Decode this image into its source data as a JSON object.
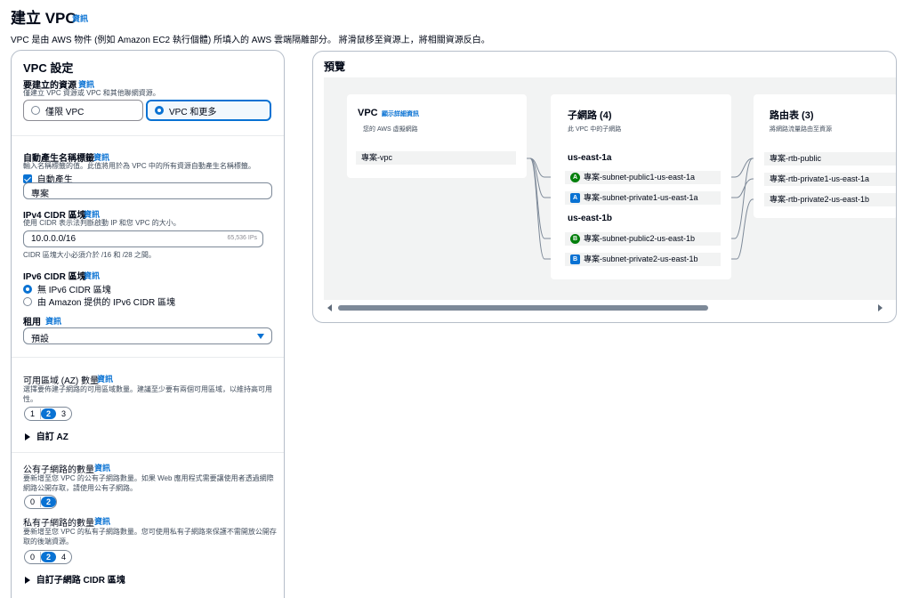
{
  "header": {
    "title": "建立 VPC",
    "info": "資訊",
    "description": "VPC 是由 AWS 物件 (例如 Amazon EC2 執行個體) 所填入的 AWS 雲端隔離部分。 將滑鼠移至資源上，將相關資源反白。"
  },
  "settings": {
    "title": "VPC 設定",
    "resources": {
      "label": "要建立的資源",
      "info": "資訊",
      "desc": "僅建立 VPC 資源或 VPC 和其他聯網資源。",
      "option_vpc_only": "僅限 VPC",
      "option_vpc_more": "VPC 和更多",
      "selected": "VPC 和更多"
    },
    "name_tag": {
      "label": "自動產生名稱標籤",
      "info": "資訊",
      "desc": "輸入名稱標籤的值。此值將用於為 VPC 中的所有資源自動產生名稱標籤。",
      "checkbox_label": "自動產生",
      "checked": true,
      "value": "專案"
    },
    "ipv4": {
      "label": "IPv4 CIDR 區塊",
      "info": "資訊",
      "desc": "使用 CIDR 表示法判斷啟動 IP 和您 VPC 的大小。",
      "value": "10.0.0.0/16",
      "ips_hint": "65,536 IPs",
      "constraint": "CIDR 區塊大小必須介於 /16 和 /28 之間。"
    },
    "ipv6": {
      "label": "IPv6 CIDR 區塊",
      "info": "資訊",
      "option_none": "無 IPv6 CIDR 區塊",
      "option_amazon": "由 Amazon 提供的 IPv6 CIDR 區塊",
      "selected": "無 IPv6 CIDR 區塊"
    },
    "tenancy": {
      "label": "租用",
      "info": "資訊",
      "value": "預設"
    },
    "az": {
      "label": "可用區域 (AZ) 數量",
      "info": "資訊",
      "desc": "選擇要佈建子網路的可用區域數量。建議至少要有兩個可用區域，以維持高可用性。",
      "options": [
        "1",
        "2",
        "3"
      ],
      "selected": "2",
      "custom": "自訂 AZ"
    },
    "public_subnets": {
      "label": "公有子網路的數量",
      "info": "資訊",
      "desc": "要新增至您 VPC 的公有子網路數量。如果 Web 應用程式需要讓使用者透過網際網路公開存取，請使用公有子網路。",
      "options": [
        "0",
        "2"
      ],
      "selected": "2"
    },
    "private_subnets": {
      "label": "私有子網路的數量",
      "info": "資訊",
      "desc": "要新增至您 VPC 的私有子網路數量。您可使用私有子網路來保護不需開放公開存取的後端資源。",
      "options": [
        "0",
        "2",
        "4"
      ],
      "selected": "2",
      "custom": "自訂子網路 CIDR 區塊"
    }
  },
  "preview": {
    "title": "預覽",
    "vpc": {
      "title": "VPC",
      "link": "顯示詳細資訊",
      "desc": "您的 AWS 虛擬網路",
      "item": "專案-vpc"
    },
    "subnets": {
      "title": "子網路 (4)",
      "desc": "此 VPC 中的子網路",
      "zones": [
        {
          "name": "us-east-1a",
          "items": [
            {
              "badge": "A",
              "type": "public",
              "name": "專案-subnet-public1-us-east-1a"
            },
            {
              "badge": "A",
              "type": "private",
              "name": "專案-subnet-private1-us-east-1a"
            }
          ]
        },
        {
          "name": "us-east-1b",
          "items": [
            {
              "badge": "B",
              "type": "public",
              "name": "專案-subnet-public2-us-east-1b"
            },
            {
              "badge": "B",
              "type": "private",
              "name": "專案-subnet-private2-us-east-1b"
            }
          ]
        }
      ]
    },
    "route_tables": {
      "title": "路由表 (3)",
      "desc": "將網路流量路由至資源",
      "items": [
        "專案-rtb-public",
        "專案-rtb-private1-us-east-1a",
        "專案-rtb-private2-us-east-1b"
      ]
    }
  },
  "colors": {
    "accent": "#0972d3",
    "public_badge": "#037f0c",
    "text": "#000716"
  }
}
